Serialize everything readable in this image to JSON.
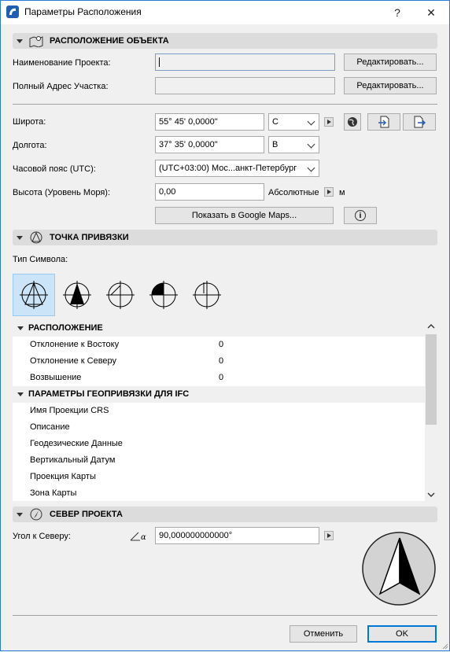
{
  "window": {
    "title": "Параметры Расположения",
    "help_glyph": "?",
    "close_glyph": "✕"
  },
  "location": {
    "header": "РАСПОЛОЖЕНИЕ ОБЪЕКТА",
    "project_name_label": "Наименование Проекта:",
    "project_name_value": "",
    "project_name_edit": "Редактировать...",
    "address_label": "Полный Адрес Участка:",
    "address_value": "",
    "address_edit": "Редактировать...",
    "latitude_label": "Широта:",
    "latitude_value": "55° 45' 0,0000\"",
    "latitude_dir": "С",
    "longitude_label": "Долгота:",
    "longitude_value": "37° 35' 0,0000\"",
    "longitude_dir": "В",
    "timezone_label": "Часовой пояс (UTC):",
    "timezone_value": "(UTC+03:00) Мос...анкт-Петербург",
    "altitude_label": "Высота (Уровень Моря):",
    "altitude_value": "0,00",
    "altitude_ref": "Абсолютные",
    "altitude_unit": "м",
    "maps_button": "Показать в Google Maps...",
    "info_glyph": "i"
  },
  "survey": {
    "header": "ТОЧКА ПРИВЯЗКИ",
    "symbol_type_label": "Тип Символа:"
  },
  "tree": {
    "groups": [
      {
        "title": "РАСПОЛОЖЕНИЕ",
        "rows": [
          {
            "label": "Отклонение к Востоку",
            "value": "0"
          },
          {
            "label": "Отклонение к Северу",
            "value": "0"
          },
          {
            "label": "Возвышение",
            "value": "0"
          }
        ]
      },
      {
        "title": "ПАРАМЕТРЫ ГЕОПРИВЯЗКИ ДЛЯ IFC",
        "rows": [
          {
            "label": "Имя Проекции CRS",
            "value": ""
          },
          {
            "label": "Описание",
            "value": ""
          },
          {
            "label": "Геодезические Данные",
            "value": ""
          },
          {
            "label": "Вертикальный Датум",
            "value": ""
          },
          {
            "label": "Проекция Карты",
            "value": ""
          },
          {
            "label": "Зона Карты",
            "value": ""
          }
        ]
      }
    ]
  },
  "north": {
    "header": "СЕВЕР ПРОЕКТА",
    "angle_label": "Угол к Северу:",
    "angle_value": "90,000000000000°"
  },
  "footer": {
    "cancel": "Отменить",
    "ok": "OK"
  }
}
